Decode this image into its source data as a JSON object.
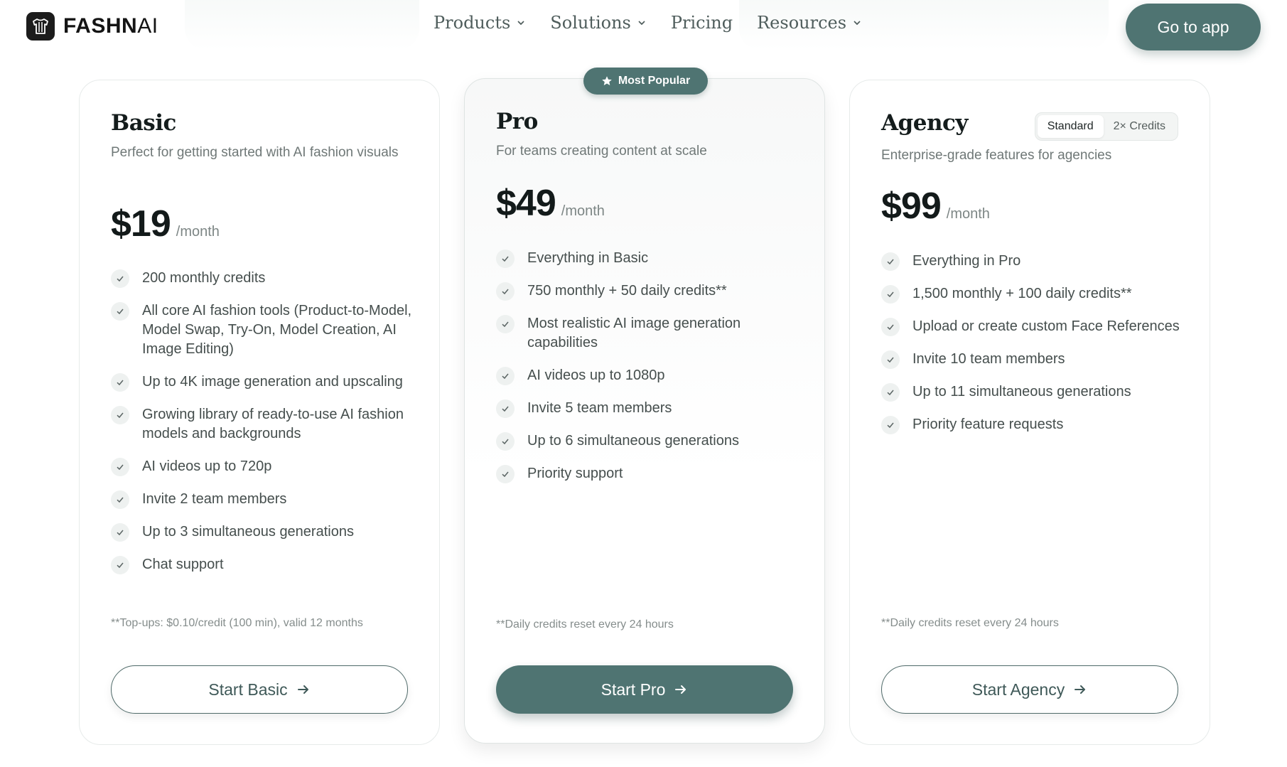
{
  "nav": {
    "brand": {
      "name_bold": "FASHN",
      "name_thin": "AI",
      "icon": "tshirt-logo-icon"
    },
    "menu": [
      {
        "label": "Products",
        "has_dropdown": true
      },
      {
        "label": "Solutions",
        "has_dropdown": true
      },
      {
        "label": "Pricing",
        "has_dropdown": false
      },
      {
        "label": "Resources",
        "has_dropdown": true
      }
    ],
    "cta": "Go to app"
  },
  "colors": {
    "accent": "#4f7472",
    "text": "#141c1c",
    "muted": "#6f7877",
    "border": "#e7ebea"
  },
  "plans": [
    {
      "name": "Basic",
      "description": "Perfect for getting started with AI fashion visuals",
      "price": "$19",
      "period": "/month",
      "features": [
        "200 monthly credits",
        "All core AI fashion tools (Product-to-Model, Model Swap, Try-On, Model Creation, AI Image Editing)",
        "Up to 4K image generation and upscaling",
        "Growing library of ready-to-use AI fashion models and backgrounds",
        "AI videos up to 720p",
        "Invite 2 team members",
        "Up to 3 simultaneous generations",
        "Chat support"
      ],
      "footnote": "**Top-ups: $0.10/credit (100 min), valid 12 months",
      "cta": "Start Basic"
    },
    {
      "name": "Pro",
      "badge": "Most Popular",
      "description": "For teams creating content at scale",
      "price": "$49",
      "period": "/month",
      "features": [
        "Everything in Basic",
        "750 monthly + 50 daily credits**",
        "Most realistic AI image generation capabilities",
        "AI videos up to 1080p",
        "Invite 5 team members",
        "Up to 6 simultaneous generations",
        "Priority support"
      ],
      "footnote": "**Daily credits reset every 24 hours",
      "cta": "Start Pro"
    },
    {
      "name": "Agency",
      "description": "Enterprise-grade features for agencies",
      "toggle": {
        "options": [
          "Standard",
          "2× Credits"
        ],
        "selected": "Standard"
      },
      "price": "$99",
      "period": "/month",
      "features": [
        "Everything in Pro",
        "1,500 monthly + 100 daily credits**",
        "Upload or create custom Face References",
        "Invite 10 team members",
        "Up to 11 simultaneous generations",
        "Priority feature requests"
      ],
      "footnote": "**Daily credits reset every 24 hours",
      "cta": "Start Agency"
    }
  ]
}
